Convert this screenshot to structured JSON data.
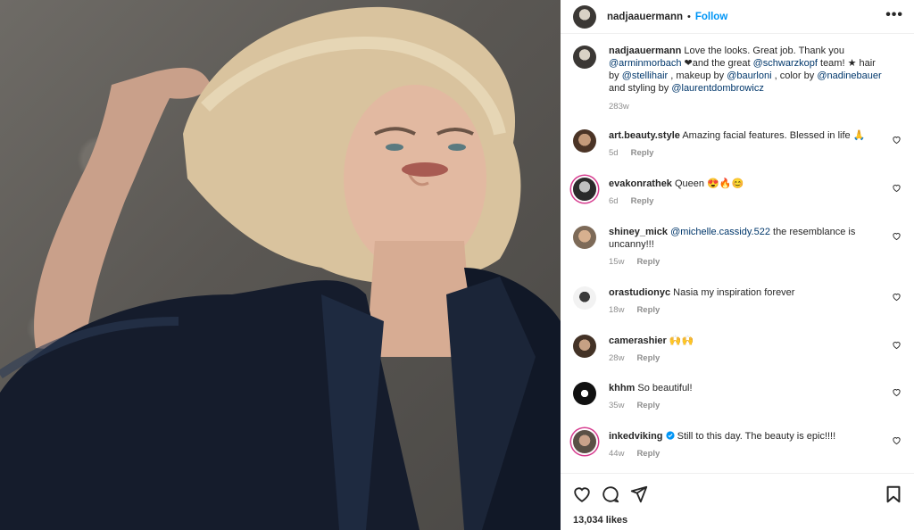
{
  "post": {
    "author": "nadjaauermann",
    "follow_label": "Follow",
    "separator": "•",
    "more_label": "•••"
  },
  "caption": {
    "username": "nadjaauermann",
    "text1": " Love the looks. Great job. Thank you ",
    "mention1": "@arminmorbach",
    "text2": " ❤and the great ",
    "mention2": "@schwarzkopf",
    "text3": " team! ★ hair by ",
    "mention3": "@stellihair",
    "text4": " , makeup by ",
    "mention4": "@baurloni",
    "text5": " , color by ",
    "mention5": "@nadinebauer",
    "text6": " and styling by ",
    "mention6": "@laurentdombrowicz",
    "time": "283w"
  },
  "comments": [
    {
      "username": "art.beauty.style",
      "text": " Amazing facial features. Blessed in life 🙏",
      "time": "5d",
      "reply": "Reply"
    },
    {
      "username": "evakonrathek",
      "text": " Queen 😍🔥😊",
      "time": "6d",
      "reply": "Reply"
    },
    {
      "username": "shiney_mick",
      "mention": "@michelle.cassidy.522",
      "text": " the resemblance is uncanny!!!",
      "time": "15w",
      "reply": "Reply"
    },
    {
      "username": "orastudionyc",
      "text": " Nasia my inspiration forever",
      "time": "18w",
      "reply": "Reply"
    },
    {
      "username": "camerashier",
      "text": " 🙌🙌",
      "time": "28w",
      "reply": "Reply"
    },
    {
      "username": "khhm",
      "text": " So beautiful!",
      "time": "35w",
      "reply": "Reply"
    },
    {
      "username": "inkedviking",
      "text": " Still to this day. The beauty is epic!!!!",
      "time": "44w",
      "reply": "Reply"
    }
  ],
  "likes": "13,034 likes",
  "icons": {
    "like": "heart-icon",
    "comment": "comment-icon",
    "share": "share-icon",
    "save": "bookmark-icon",
    "verified": "verified-badge-icon"
  },
  "colors": {
    "accent": "#0095f6",
    "mention": "#00376b",
    "muted": "#8e8e8e",
    "story_ring": "#d63b8e"
  }
}
